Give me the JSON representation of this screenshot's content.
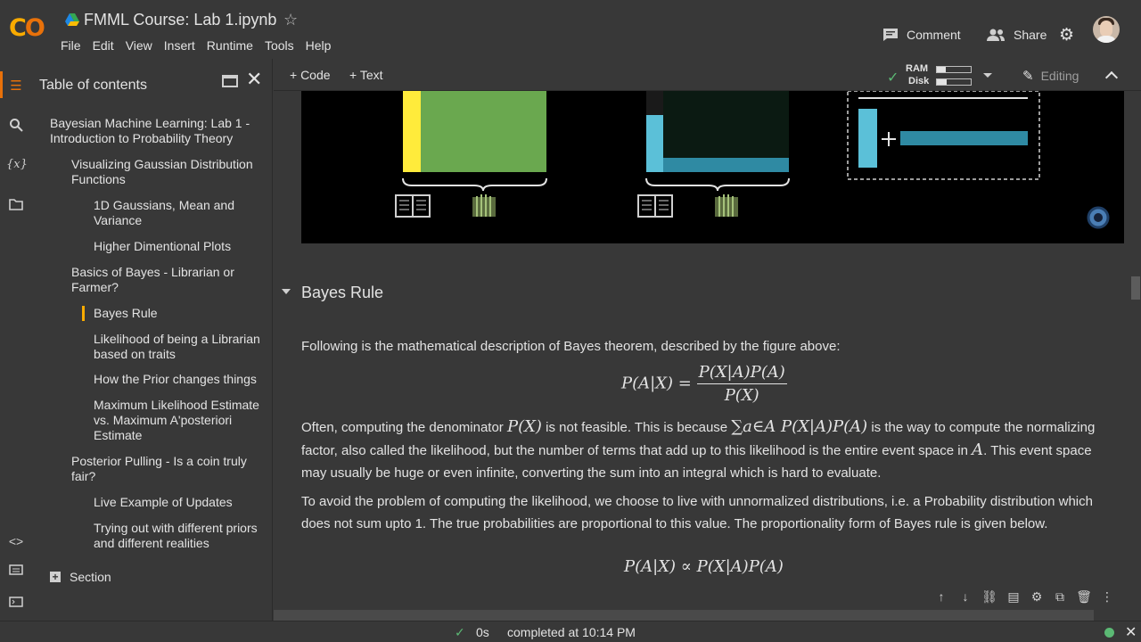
{
  "app": {
    "logo_text": "CO",
    "title": "FMML Course: Lab 1.ipynb",
    "menu": [
      "File",
      "Edit",
      "View",
      "Insert",
      "Runtime",
      "Tools",
      "Help"
    ],
    "actions": {
      "comment": "Comment",
      "share": "Share"
    }
  },
  "toolbar": {
    "code_label": "+ Code",
    "text_label": "+ Text",
    "ram_label": "RAM",
    "disk_label": "Disk",
    "editing_label": "Editing",
    "ram_fraction": 0.25,
    "disk_fraction": 0.3
  },
  "sidebar": {
    "title": "Table of contents",
    "items": [
      {
        "label": "Bayesian Machine Learning: Lab 1 - Introduction to Probability Theory",
        "level": 1
      },
      {
        "label": "Visualizing Gaussian Distribution Functions",
        "level": 2
      },
      {
        "label": "1D Gaussians, Mean and Variance",
        "level": 3
      },
      {
        "label": "Higher Dimentional Plots",
        "level": 3
      },
      {
        "label": "Basics of Bayes - Librarian or Farmer?",
        "level": 2
      },
      {
        "label": "Bayes Rule",
        "level": 3,
        "active": true
      },
      {
        "label": "Likelihood of being a Librarian based on traits",
        "level": 3
      },
      {
        "label": "How the Prior changes things",
        "level": 3
      },
      {
        "label": "Maximum Likelihood Estimate vs. Maximum A'posteriori Estimate",
        "level": 3
      },
      {
        "label": "Posterior Pulling - Is a coin truly fair?",
        "level": 2
      },
      {
        "label": "Live Example of Updates",
        "level": 3
      },
      {
        "label": "Trying out with different priors and different realities",
        "level": 3
      }
    ],
    "section_label": "Section"
  },
  "notebook": {
    "section_heading": "Bayes Rule",
    "para1": "Following is the mathematical description of Bayes theorem, described by the figure above:",
    "eq1_lhs": "P(A|X) =",
    "eq1_num": "P(X|A)P(A)",
    "eq1_den": "P(X)",
    "para2_a": "Often, computing the denominator",
    "para2_math1": "P(X)",
    "para2_b": "is not feasible. This is because",
    "para2_math2": "∑a∈A P(X|A)P(A)",
    "para2_c": "is the way to compute the normalizing factor, also called the likelihood, but the number of terms that add up to this likelihood is the entire event space in",
    "para2_math3": "A",
    "para2_d": ". This event space may usually be huge or even infinite, converting the sum into an integral which is hard to evaluate.",
    "para3": "To avoid the problem of computing the likelihood, we choose to live with unnormalized distributions, i.e. a Probability distribution which does not sum upto 1. The true probabilities are proportional to this value. The proportionality form of Bayes rule is given below.",
    "eq2": "P(A|X) ∝ P(X|A)P(A)"
  },
  "status": {
    "elapsed": "0s",
    "completed": "completed at 10:14 PM"
  },
  "colors": {
    "yellow": "#ffeb3b",
    "green": "#6aa84f",
    "cyan": "#5bc0d8",
    "teal": "#2f8aa3"
  }
}
